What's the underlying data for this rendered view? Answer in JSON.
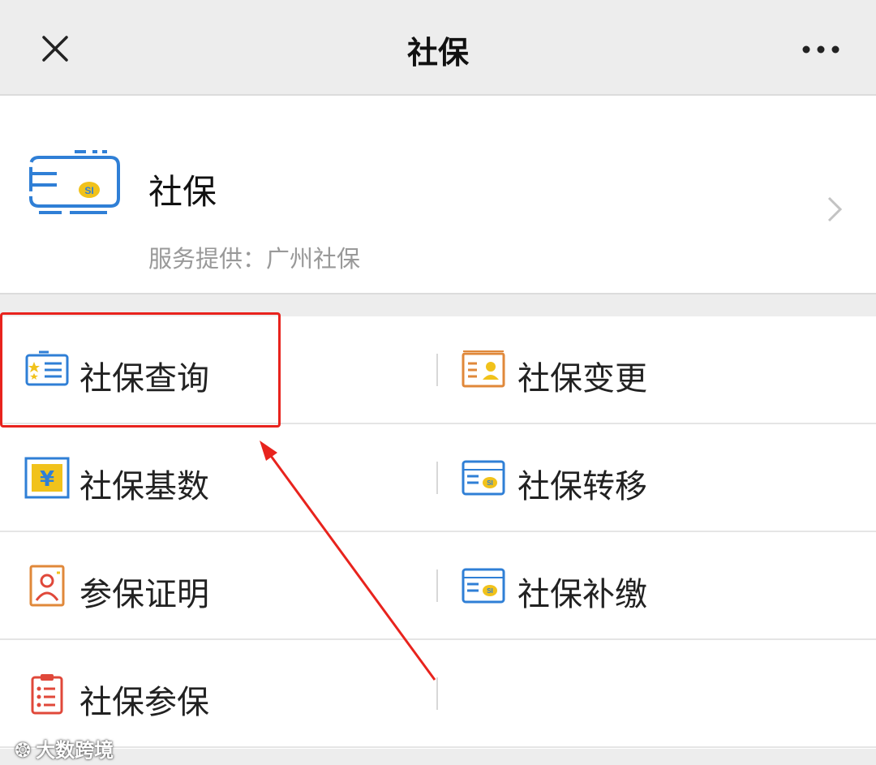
{
  "topbar": {
    "title": "社保",
    "close_icon": "close-icon",
    "more_icon": "more-icon"
  },
  "service": {
    "name": "社保",
    "provider": "服务提供：广州社保"
  },
  "grid": [
    {
      "left": {
        "label": "社保查询",
        "icon": "id-card-icon"
      },
      "right": {
        "label": "社保变更",
        "icon": "profile-card-icon"
      }
    },
    {
      "left": {
        "label": "社保基数",
        "icon": "yuan-icon"
      },
      "right": {
        "label": "社保转移",
        "icon": "si-card-icon"
      }
    },
    {
      "left": {
        "label": "参保证明",
        "icon": "person-certificate-icon"
      },
      "right": {
        "label": "社保补缴",
        "icon": "si-card-icon"
      }
    },
    {
      "left": {
        "label": "社保参保",
        "icon": "clipboard-list-icon"
      },
      "right": {
        "label": "",
        "icon": ""
      }
    }
  ],
  "watermark": "大数跨境",
  "colors": {
    "highlight": "#e8231d",
    "blue": "#2f7fd6",
    "orange": "#e0883a",
    "yellow": "#f1c21b",
    "red": "#e0483a"
  }
}
